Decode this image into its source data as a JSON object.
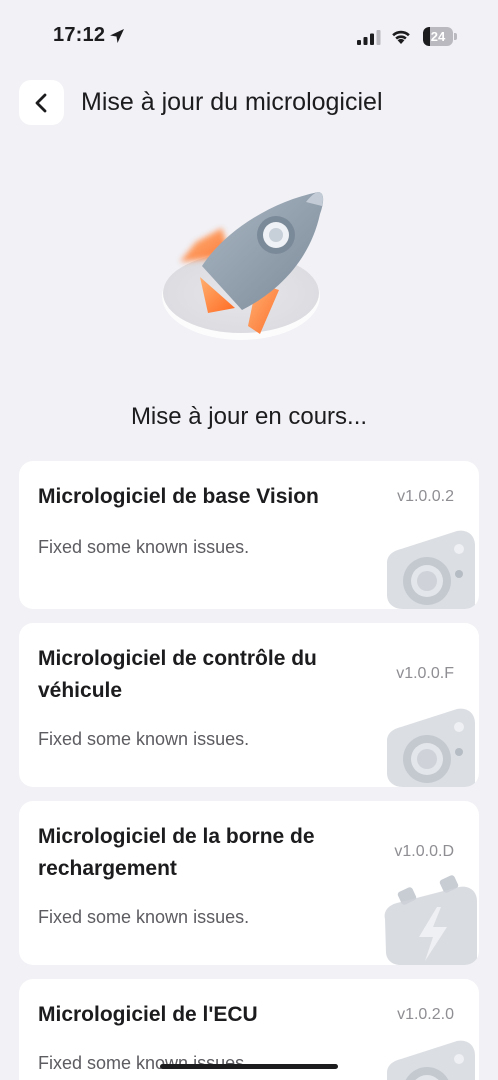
{
  "status_bar": {
    "time": "17:12",
    "battery": "24",
    "battery_level": 0.24
  },
  "header": {
    "title": "Mise à jour du micrologiciel",
    "back_icon": "chevron-left-icon"
  },
  "hero": {
    "icon": "rocket-icon",
    "status_text": "Mise à jour en cours..."
  },
  "firmware": [
    {
      "title": "Micrologiciel de base Vision",
      "version": "v1.0.0.2",
      "description": "Fixed some known issues.",
      "icon": "camera-icon"
    },
    {
      "title": "Micrologiciel de contrôle du véhicule",
      "version": "v1.0.0.F",
      "description": "Fixed some known issues.",
      "icon": "camera-icon"
    },
    {
      "title": "Micrologiciel de la borne de rechargement",
      "version": "v1.0.0.D",
      "description": "Fixed some known issues.",
      "icon": "battery-charging-icon"
    },
    {
      "title": "Micrologiciel de l'ECU",
      "version": "v1.0.2.0",
      "description": "Fixed some known issues.",
      "icon": "camera-icon"
    }
  ],
  "colors": {
    "background": "#f1f1f6",
    "accent_orange": "#ff7a2f",
    "rocket_gray": "#8a98a6",
    "card": "#ffffff"
  }
}
